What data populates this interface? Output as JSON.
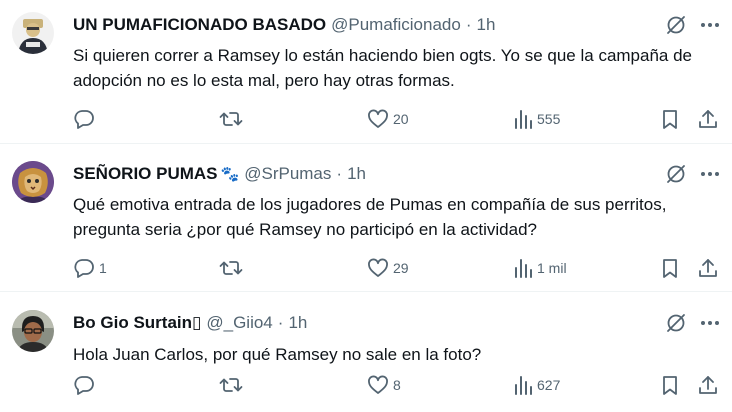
{
  "colors": {
    "text": "#0f1419",
    "secondary": "#536471",
    "divider": "#eff3f4"
  },
  "tweets": [
    {
      "name": "UN PUMAFICIONADO BASADO",
      "handle": "@Pumaficionado",
      "separator": "·",
      "time": "1h",
      "text": "Si quieren correr a Ramsey lo están haciendo bien ogts. Yo se que la campaña de adopción no es lo esta mal, pero hay otras formas.",
      "replies": "",
      "retweets": "",
      "likes": "20",
      "views": "555"
    },
    {
      "name": "SEÑORIO PUMAS",
      "name_emoji": "🐾",
      "handle": "@SrPumas",
      "separator": "·",
      "time": "1h",
      "text": "Qué emotiva entrada de los jugadores de Pumas en compañía de sus perritos, pregunta seria ¿por qué Ramsey no participó en la actividad?",
      "replies": "1",
      "retweets": "",
      "likes": "29",
      "views": "1 mil"
    },
    {
      "name": "Bo Gio Surtain",
      "name_emoji": "▯",
      "handle": "@_Giio4",
      "separator": "·",
      "time": "1h",
      "text": "Hola Juan Carlos, por qué Ramsey no sale en la foto?",
      "replies": "",
      "retweets": "",
      "likes": "8",
      "views": "627"
    }
  ],
  "icons": [
    "grok-icon",
    "more-icon",
    "reply-icon",
    "retweet-icon",
    "like-icon",
    "views-icon",
    "bookmark-icon",
    "share-icon"
  ]
}
